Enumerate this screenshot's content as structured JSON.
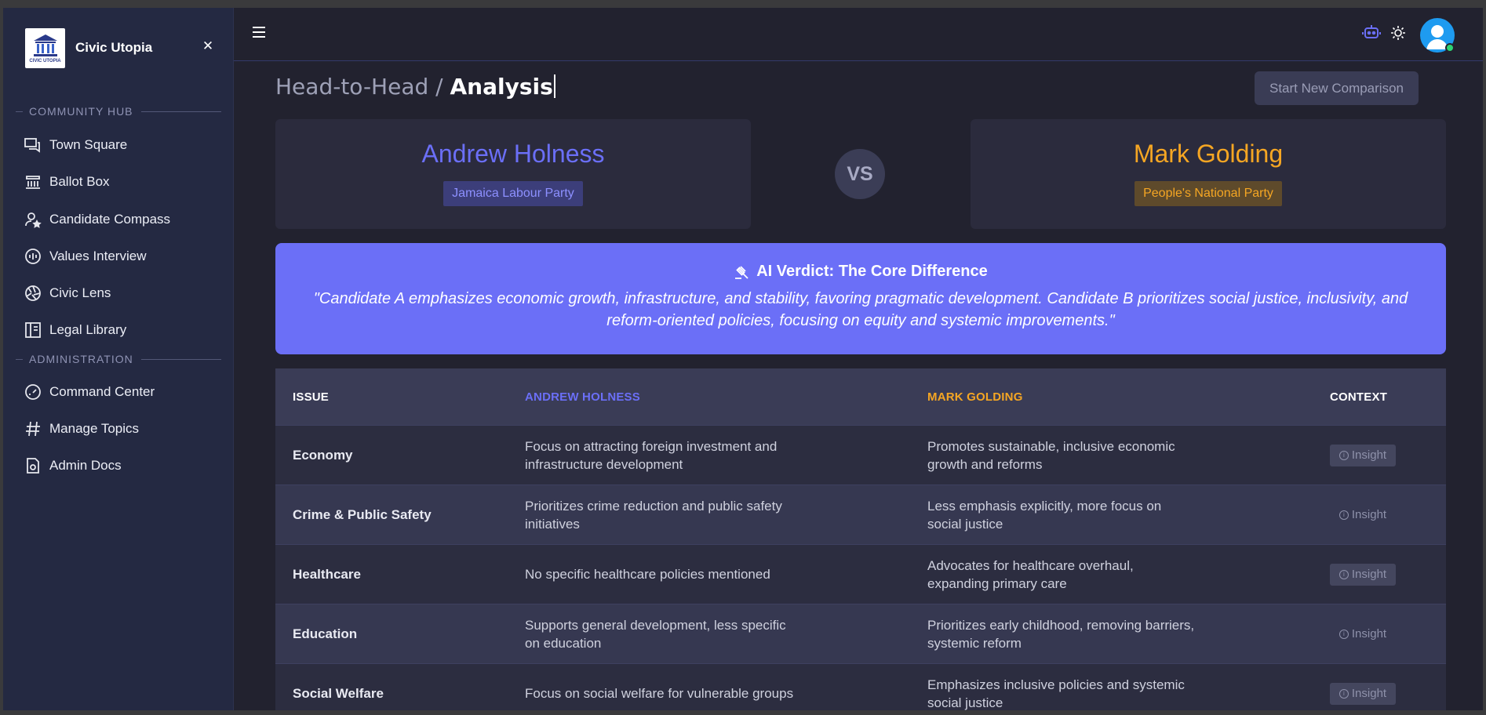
{
  "app": {
    "name": "Civic Utopia",
    "logo_text": "CIVIC UTOPIA"
  },
  "sidebar": {
    "sections": [
      {
        "label": "COMMUNITY HUB",
        "items": [
          {
            "label": "Town Square",
            "icon": "chat-bubbles-icon"
          },
          {
            "label": "Ballot Box",
            "icon": "bank-icon"
          },
          {
            "label": "Candidate Compass",
            "icon": "user-star-icon"
          },
          {
            "label": "Values Interview",
            "icon": "audio-waves-icon"
          },
          {
            "label": "Civic Lens",
            "icon": "aperture-icon"
          },
          {
            "label": "Legal Library",
            "icon": "book-layout-icon"
          }
        ]
      },
      {
        "label": "ADMINISTRATION",
        "items": [
          {
            "label": "Command Center",
            "icon": "gauge-icon"
          },
          {
            "label": "Manage Topics",
            "icon": "hashtag-icon"
          },
          {
            "label": "Admin Docs",
            "icon": "document-gear-icon"
          }
        ]
      }
    ]
  },
  "header": {
    "breadcrumb_parent": "Head-to-Head / ",
    "breadcrumb_current": "Analysis",
    "start_button": "Start New Comparison"
  },
  "colors": {
    "candidate_a": "#6b6ff7",
    "candidate_b": "#f5a623",
    "verdict_bg": "#6b6ff7",
    "online": "#2ed573"
  },
  "candidates": {
    "a": {
      "name": "Andrew Holness",
      "party": "Jamaica Labour Party"
    },
    "b": {
      "name": "Mark Golding",
      "party": "People's National Party"
    },
    "vs_label": "VS"
  },
  "verdict": {
    "title": "AI Verdict: The Core Difference",
    "text": "\"Candidate A emphasizes economic growth, infrastructure, and stability, favoring pragmatic development. Candidate B prioritizes social justice, inclusivity, and reform-oriented policies, focusing on equity and systemic improvements.\""
  },
  "table": {
    "headers": {
      "issue": "ISSUE",
      "a": "ANDREW HOLNESS",
      "b": "MARK GOLDING",
      "context": "CONTEXT"
    },
    "insight_label": "Insight",
    "rows": [
      {
        "issue": "Economy",
        "a": "Focus on attracting foreign investment and infrastructure development",
        "b": "Promotes sustainable, inclusive economic growth and reforms"
      },
      {
        "issue": "Crime & Public Safety",
        "a": "Prioritizes crime reduction and public safety initiatives",
        "b": "Less emphasis explicitly, more focus on social justice"
      },
      {
        "issue": "Healthcare",
        "a": "No specific healthcare policies mentioned",
        "b": "Advocates for healthcare overhaul, expanding primary care"
      },
      {
        "issue": "Education",
        "a": "Supports general development, less specific on education",
        "b": "Prioritizes early childhood, removing barriers, systemic reform"
      },
      {
        "issue": "Social Welfare",
        "a": "Focus on social welfare for vulnerable groups",
        "b": "Emphasizes inclusive policies and systemic social justice"
      }
    ]
  }
}
